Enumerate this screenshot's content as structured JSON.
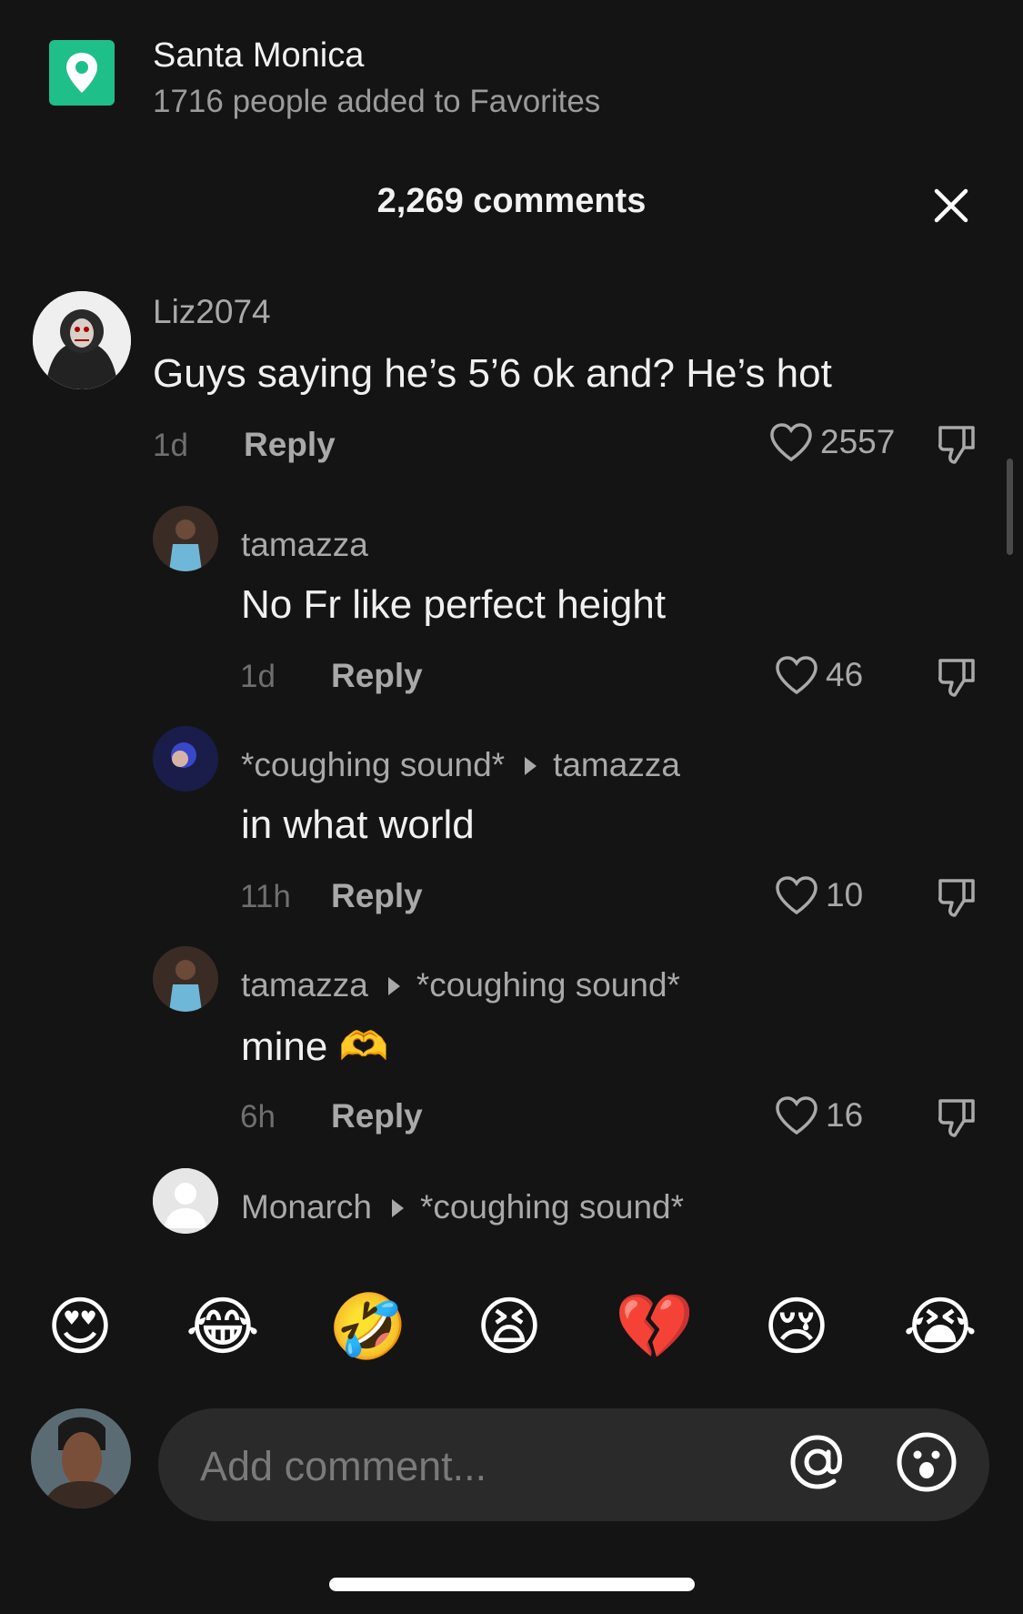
{
  "location": {
    "title": "Santa Monica",
    "subtitle": "1716 people added to Favorites",
    "icon": "location-pin-icon",
    "accent": "#1fbf8a"
  },
  "header": {
    "title": "2,269 comments",
    "close_icon": "close-icon"
  },
  "comments": [
    {
      "user": "Liz2074",
      "text": "Guys saying he’s 5’6 ok and? He’s hot",
      "time": "1d",
      "reply": "Reply",
      "likes": "2557"
    },
    {
      "user": "tamazza",
      "text": "No Fr like perfect height",
      "time": "1d",
      "reply": "Reply",
      "likes": "46"
    },
    {
      "user": "*coughing sound*",
      "reply_to": "tamazza",
      "text": "in what world",
      "time": "11h",
      "reply": "Reply",
      "likes": "10"
    },
    {
      "user": "tamazza",
      "reply_to": "*coughing sound*",
      "text": "mine 🫶",
      "time": "6h",
      "reply": "Reply",
      "likes": "16"
    },
    {
      "user": "Monarch",
      "reply_to": "*coughing sound*"
    }
  ],
  "emojis": [
    "😍",
    "😂",
    "🤣",
    "😫",
    "💔",
    "😢",
    "😭"
  ],
  "composer": {
    "placeholder": "Add comment...",
    "mention_icon": "at-icon",
    "emoji_icon": "smile-icon"
  }
}
